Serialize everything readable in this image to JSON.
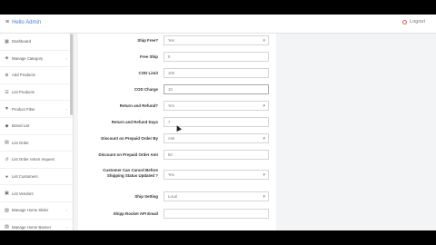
{
  "header": {
    "title": "Hello Admin",
    "logout_label": "Logout"
  },
  "sidebar": {
    "items": [
      {
        "label": "Dashboard",
        "icon": "dashboard-icon",
        "has_chevron": false
      },
      {
        "label": "Manage Category",
        "icon": "category-icon",
        "has_chevron": true
      },
      {
        "label": "Add Products",
        "icon": "plus-icon",
        "has_chevron": false
      },
      {
        "label": "List Products",
        "icon": "list-icon",
        "has_chevron": false
      },
      {
        "label": "Product Filter",
        "icon": "filter-icon",
        "has_chevron": true
      },
      {
        "label": "Brand List",
        "icon": "tag-icon",
        "has_chevron": false
      },
      {
        "label": "List Order",
        "icon": "cart-icon",
        "has_chevron": false
      },
      {
        "label": "List Order return request",
        "icon": "return-icon",
        "has_chevron": false
      },
      {
        "label": "List Customers",
        "icon": "users-icon",
        "has_chevron": false
      },
      {
        "label": "List Vendors",
        "icon": "store-icon",
        "has_chevron": false
      },
      {
        "label": "Manage Home Slider",
        "icon": "image-icon",
        "has_chevron": true
      },
      {
        "label": "Manage Home Banner",
        "icon": "image-icon",
        "has_chevron": true
      }
    ]
  },
  "form": {
    "ship_free": {
      "label": "Ship Free?",
      "value": "Yes"
    },
    "free_ship": {
      "label": "Free Ship",
      "value": "0"
    },
    "cod_limit": {
      "label": "COD Limit",
      "value": "100"
    },
    "cod_charge": {
      "label": "COD Charge",
      "value": "10"
    },
    "return_refund": {
      "label": "Return and Refund?",
      "value": "Yes"
    },
    "return_refund_days": {
      "label": "Return and Refund Days",
      "value": "7"
    },
    "discount_prepaid_by": {
      "label": "Discount on Prepaid Order By",
      "value": "Amt"
    },
    "discount_prepaid_amt": {
      "label": "Discount on Prepaid Order Amt",
      "value": "50"
    },
    "customer_cancel": {
      "label": "Customer Can Cancel Before Shipping Status Updated ?",
      "value": "Yes"
    },
    "ship_setting": {
      "label": "Ship Setting",
      "value": "Local"
    },
    "shiprocket_email": {
      "label": "Shipp Rocket API Email",
      "value": ""
    }
  }
}
